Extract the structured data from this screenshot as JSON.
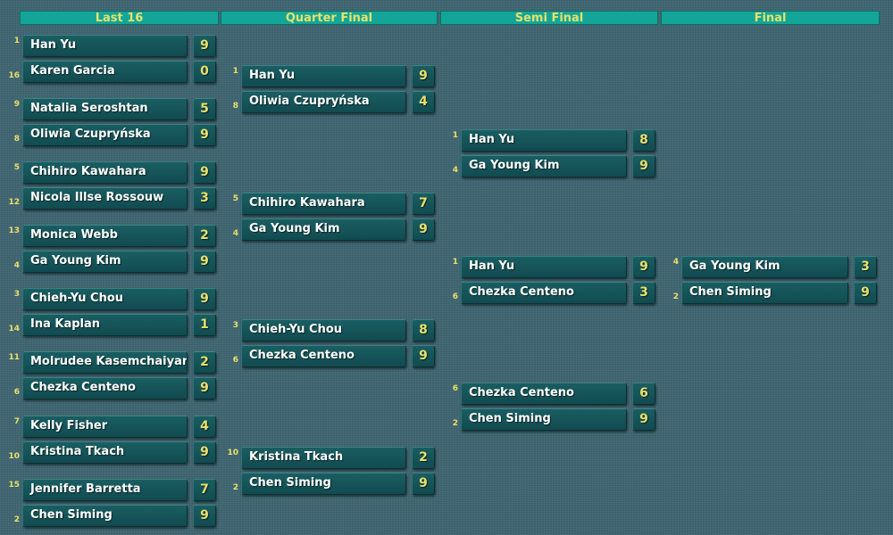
{
  "rounds": [
    {
      "title": "Last 16",
      "matches": [
        [
          {
            "seed": "1",
            "name": "Han Yu",
            "score": "9"
          },
          {
            "seed": "16",
            "name": "Karen Garcia",
            "score": "0"
          }
        ],
        [
          {
            "seed": "9",
            "name": "Natalia Seroshtan",
            "score": "5"
          },
          {
            "seed": "8",
            "name": "Oliwia Czupryńska",
            "score": "9"
          }
        ],
        [
          {
            "seed": "5",
            "name": "Chihiro Kawahara",
            "score": "9"
          },
          {
            "seed": "12",
            "name": "Nicola Illse Rossouw",
            "score": "3"
          }
        ],
        [
          {
            "seed": "13",
            "name": "Monica Webb",
            "score": "2"
          },
          {
            "seed": "4",
            "name": "Ga Young Kim",
            "score": "9"
          }
        ],
        [
          {
            "seed": "3",
            "name": "Chieh-Yu Chou",
            "score": "9"
          },
          {
            "seed": "14",
            "name": "Ina Kaplan",
            "score": "1"
          }
        ],
        [
          {
            "seed": "11",
            "name": "Molrudee Kasemchaiyanan",
            "score": "2"
          },
          {
            "seed": "6",
            "name": "Chezka Centeno",
            "score": "9"
          }
        ],
        [
          {
            "seed": "7",
            "name": "Kelly Fisher",
            "score": "4"
          },
          {
            "seed": "10",
            "name": "Kristina Tkach",
            "score": "9"
          }
        ],
        [
          {
            "seed": "15",
            "name": "Jennifer Barretta",
            "score": "7"
          },
          {
            "seed": "2",
            "name": "Chen Siming",
            "score": "9"
          }
        ]
      ]
    },
    {
      "title": "Quarter Final",
      "matches": [
        [
          {
            "seed": "1",
            "name": "Han Yu",
            "score": "9"
          },
          {
            "seed": "8",
            "name": "Oliwia Czupryńska",
            "score": "4"
          }
        ],
        [
          {
            "seed": "5",
            "name": "Chihiro Kawahara",
            "score": "7"
          },
          {
            "seed": "4",
            "name": "Ga Young Kim",
            "score": "9"
          }
        ],
        [
          {
            "seed": "3",
            "name": "Chieh-Yu Chou",
            "score": "8"
          },
          {
            "seed": "6",
            "name": "Chezka Centeno",
            "score": "9"
          }
        ],
        [
          {
            "seed": "10",
            "name": "Kristina Tkach",
            "score": "2"
          },
          {
            "seed": "2",
            "name": "Chen Siming",
            "score": "9"
          }
        ]
      ]
    },
    {
      "title": "Semi Final",
      "matches": [
        [
          {
            "seed": "1",
            "name": "Han Yu",
            "score": "8"
          },
          {
            "seed": "4",
            "name": "Ga Young Kim",
            "score": "9"
          }
        ],
        [
          {
            "seed": "1",
            "name": "Han Yu",
            "score": "9"
          },
          {
            "seed": "6",
            "name": "Chezka Centeno",
            "score": "3"
          }
        ],
        [
          {
            "seed": "6",
            "name": "Chezka Centeno",
            "score": "6"
          },
          {
            "seed": "2",
            "name": "Chen Siming",
            "score": "9"
          }
        ]
      ]
    },
    {
      "title": "Final",
      "matches": [
        [
          {
            "seed": "4",
            "name": "Ga Young Kim",
            "score": "3"
          },
          {
            "seed": "2",
            "name": "Chen Siming",
            "score": "9"
          }
        ]
      ]
    }
  ]
}
